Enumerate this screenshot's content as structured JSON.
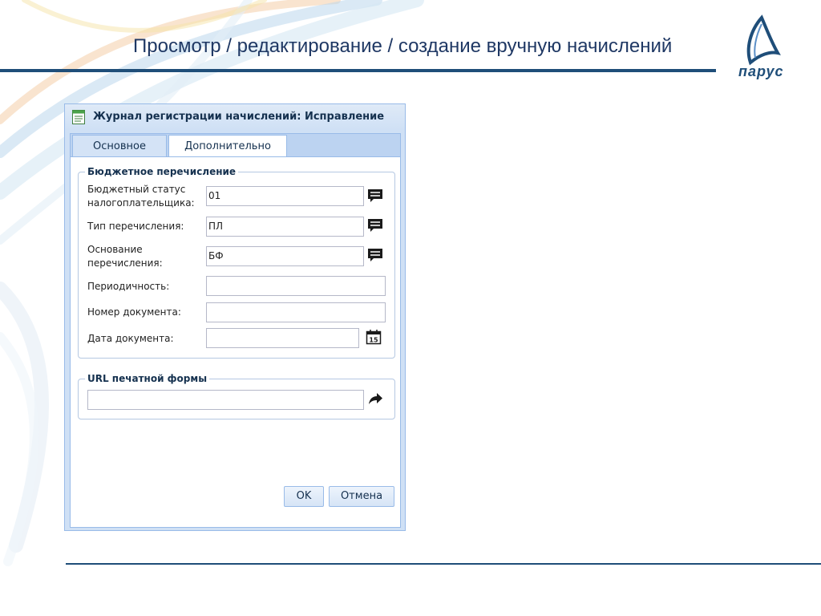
{
  "slide": {
    "title": "Просмотр / редактирование / создание вручную начислений",
    "logo_text": "парус"
  },
  "dialog": {
    "title": "Журнал регистрации начислений: Исправление",
    "tabs": [
      {
        "label": "Основное",
        "active": false
      },
      {
        "label": "Дополнительно",
        "active": true
      }
    ],
    "budget_group": {
      "legend": "Бюджетное перечисление",
      "fields": {
        "taxpayer_status": {
          "label_line1": "Бюджетный статус",
          "label_line2": "налогоплательщика:",
          "value": "01"
        },
        "transfer_type": {
          "label": "Тип перечисления:",
          "value": "ПЛ"
        },
        "transfer_basis": {
          "label_line1": "Основание",
          "label_line2": "перечисления:",
          "value": "БФ"
        },
        "periodicity": {
          "label": "Периодичность:",
          "value": ""
        },
        "doc_number": {
          "label": "Номер документа:",
          "value": ""
        },
        "doc_date": {
          "label": "Дата документа:",
          "value": "",
          "calendar_day": "15"
        }
      }
    },
    "url_group": {
      "legend": "URL печатной формы",
      "value": ""
    },
    "buttons": {
      "ok": "OK",
      "cancel": "Отмена"
    }
  },
  "colors": {
    "title_blue": "#1f3864",
    "rule_blue": "#1f4e79",
    "dialog_frame": "#99bbe8"
  },
  "icons": [
    "dialog-journal-icon",
    "dictionary-icon",
    "calendar-icon",
    "navigate-arrow-icon",
    "sail-logo-icon"
  ]
}
